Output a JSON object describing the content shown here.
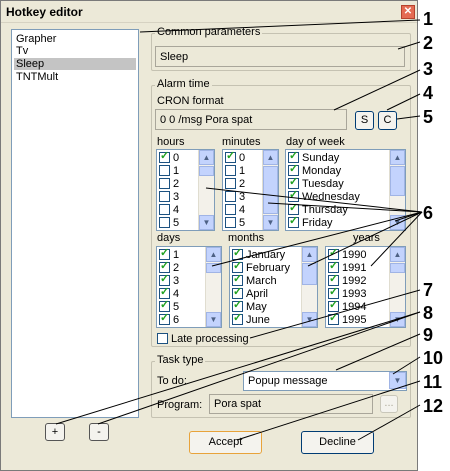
{
  "window": {
    "title": "Hotkey editor"
  },
  "modules": [
    "Grapher",
    "Tv",
    "Sleep",
    "TNTMult"
  ],
  "common": {
    "label": "Common parameters",
    "name_value": "Sleep"
  },
  "alarm": {
    "label": "Alarm time",
    "cron_label": "CRON format",
    "cron_value": "0 0 /msg Pora spat",
    "s_button": "S",
    "c_button": "C",
    "hours_label": "hours",
    "minutes_label": "minutes",
    "dow_label": "day of week",
    "days_label": "days",
    "months_label": "months",
    "years_label": "years",
    "hours": [
      {
        "text": "0",
        "checked": true
      },
      {
        "text": "1",
        "checked": false
      },
      {
        "text": "2",
        "checked": false
      },
      {
        "text": "3",
        "checked": false
      },
      {
        "text": "4",
        "checked": false
      },
      {
        "text": "5",
        "checked": false
      }
    ],
    "minutes": [
      {
        "text": "0",
        "checked": true
      },
      {
        "text": "1",
        "checked": false
      },
      {
        "text": "2",
        "checked": false
      },
      {
        "text": "3",
        "checked": false
      },
      {
        "text": "4",
        "checked": false
      },
      {
        "text": "5",
        "checked": false
      }
    ],
    "dow": [
      {
        "text": "Sunday",
        "checked": true
      },
      {
        "text": "Monday",
        "checked": true
      },
      {
        "text": "Tuesday",
        "checked": true
      },
      {
        "text": "Wednesday",
        "checked": true
      },
      {
        "text": "Thursday",
        "checked": true
      },
      {
        "text": "Friday",
        "checked": true
      }
    ],
    "days": [
      {
        "text": "1",
        "checked": true
      },
      {
        "text": "2",
        "checked": true
      },
      {
        "text": "3",
        "checked": true
      },
      {
        "text": "4",
        "checked": true
      },
      {
        "text": "5",
        "checked": true
      },
      {
        "text": "6",
        "checked": true
      }
    ],
    "months": [
      {
        "text": "January",
        "checked": true
      },
      {
        "text": "February",
        "checked": true
      },
      {
        "text": "March",
        "checked": true
      },
      {
        "text": "April",
        "checked": true
      },
      {
        "text": "May",
        "checked": true
      },
      {
        "text": "June",
        "checked": true
      }
    ],
    "years": [
      {
        "text": "1990",
        "checked": true
      },
      {
        "text": "1991",
        "checked": true
      },
      {
        "text": "1992",
        "checked": true
      },
      {
        "text": "1993",
        "checked": true
      },
      {
        "text": "1994",
        "checked": true
      },
      {
        "text": "1995",
        "checked": true
      }
    ],
    "late_processing": "Late processing"
  },
  "task": {
    "label": "Task type",
    "todo_label": "To do:",
    "todo_value": "Popup message",
    "program_label": "Program:",
    "program_value": "Pora spat",
    "browse_label": "..."
  },
  "buttons": {
    "add": "+",
    "remove": "-",
    "accept": "Accept",
    "decline": "Decline"
  },
  "callouts": [
    "1",
    "2",
    "3",
    "4",
    "5",
    "6",
    "7",
    "8",
    "9",
    "10",
    "11",
    "12"
  ],
  "icons": {
    "close": "close-icon",
    "scroll_up": "scroll-up-icon",
    "scroll_down": "scroll-down-icon",
    "dropdown": "chevron-down-icon"
  }
}
